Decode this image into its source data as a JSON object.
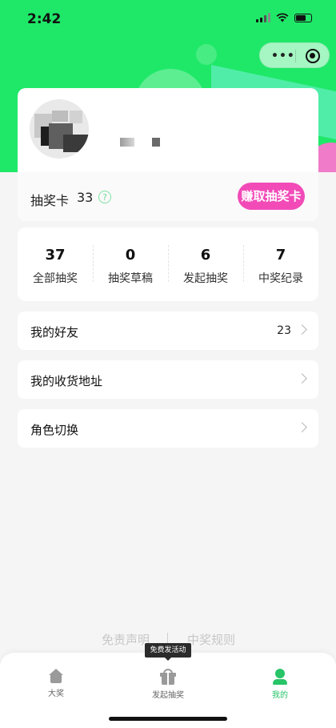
{
  "status_bar": {
    "time": "2:42"
  },
  "capsule": {
    "more_icon": "more-dots-icon",
    "close_icon": "target-circle-icon"
  },
  "profile": {
    "lottery_card_label": "抽奖卡",
    "lottery_card_count": "33",
    "help_icon": "question-icon",
    "earn_button_label": "赚取抽奖卡",
    "accent_color": "#f24bb8"
  },
  "stats": [
    {
      "value": "37",
      "label": "全部抽奖"
    },
    {
      "value": "0",
      "label": "抽奖草稿"
    },
    {
      "value": "6",
      "label": "发起抽奖"
    },
    {
      "value": "7",
      "label": "中奖纪录"
    }
  ],
  "menu": {
    "friends": {
      "label": "我的好友",
      "value": "23"
    },
    "address": {
      "label": "我的收货地址"
    },
    "role": {
      "label": "角色切换"
    }
  },
  "footer": {
    "disclaimer": "免责声明",
    "rules": "中奖规则"
  },
  "tooltip": "免费发活动",
  "tabs": [
    {
      "label": "大奖",
      "icon": "home-icon"
    },
    {
      "label": "发起抽奖",
      "icon": "gift-icon"
    },
    {
      "label": "我的",
      "icon": "user-icon"
    }
  ],
  "colors": {
    "header_green": "#1fe868",
    "tab_active": "#27c468"
  }
}
